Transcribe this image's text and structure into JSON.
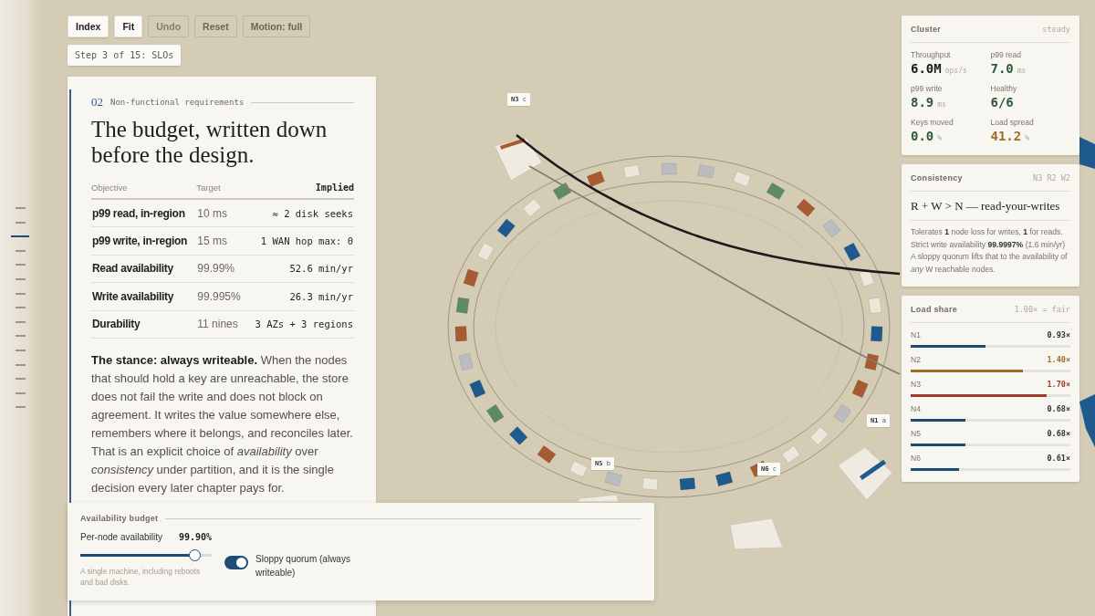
{
  "steps": [
    {
      "selected": false
    },
    {
      "selected": false
    },
    {
      "selected": true
    },
    {
      "selected": false
    },
    {
      "selected": false
    },
    {
      "selected": false
    },
    {
      "selected": false
    },
    {
      "selected": false
    },
    {
      "selected": false
    },
    {
      "selected": false
    },
    {
      "selected": false
    },
    {
      "selected": false
    },
    {
      "selected": false
    },
    {
      "selected": false
    },
    {
      "selected": false
    }
  ],
  "toolbar": [
    {
      "label": "Index",
      "kind": "filled",
      "disabled": false
    },
    {
      "label": "Fit",
      "kind": "filled",
      "disabled": false
    },
    {
      "label": "Undo",
      "kind": "outlined",
      "disabled": true
    },
    {
      "label": "Reset",
      "kind": "outlined",
      "disabled": false
    },
    {
      "label": "Motion: full",
      "kind": "outlined",
      "disabled": false
    }
  ],
  "step_label": "Step 3 of 15: SLOs",
  "chapter": {
    "number": "02",
    "label": "Non-functional requirements",
    "title": "The budget, written down before the design.",
    "table": {
      "columns": [
        "Objective",
        "Target",
        "Implied"
      ],
      "rows": [
        {
          "objective": "p99 read, in-region",
          "target": "10 ms",
          "implied": "≈ 2 disk seeks"
        },
        {
          "objective": "p99 write, in-region",
          "target": "15 ms",
          "implied": "1 WAN hop max: 0"
        },
        {
          "objective": "Read availability",
          "target": "99.99%",
          "implied": "52.6 min/yr"
        },
        {
          "objective": "Write availability",
          "target": "99.995%",
          "implied": "26.3 min/yr"
        },
        {
          "objective": "Durability",
          "target": "11 nines",
          "implied": "3 AZs + 3 regions"
        }
      ]
    },
    "body": "**The stance: always writeable.** When the nodes that should hold a key are unreachable, the store does not fail the write and does not block on agreement. It writes the value somewhere else, remembers where it belongs, and reconciles later. That is an explicit choice of *availability* over *consistency* under partition, and it is the single decision every later chapter pays for."
  },
  "budget": {
    "title": "Availability budget",
    "slider": {
      "label": "Per-node availability",
      "reading": "99.90%",
      "level": 0.87,
      "hint": "A single machine, including reboots and bad disks."
    },
    "toggle": {
      "label": "Sloppy quorum (always writeable)",
      "on": true
    }
  },
  "node_labels": [
    {
      "node": "N3",
      "replica": "c"
    },
    {
      "node": "N5",
      "replica": "b"
    },
    {
      "node": "N6",
      "replica": "c"
    },
    {
      "node": "N1",
      "replica": "a"
    }
  ],
  "cluster": {
    "title": "Cluster",
    "status": "steady",
    "metrics": [
      {
        "label": "Throughput",
        "value": "6.0M",
        "unit": "ops/s",
        "color": "#1c1c1c"
      },
      {
        "label": "p99 read",
        "value": "7.0",
        "unit": "ms",
        "color": "#2f5a3c"
      },
      {
        "label": "p99 write",
        "value": "8.9",
        "unit": "ms",
        "color": "#2f5a3c"
      },
      {
        "label": "Healthy",
        "value": "6/6",
        "color": "#2f5a3c"
      },
      {
        "label": "Keys moved",
        "value": "0.0",
        "unit": "%",
        "color": "#2f5a3c"
      },
      {
        "label": "Load spread",
        "value": "41.2",
        "unit": "%",
        "color": "#9a6f22"
      }
    ]
  },
  "consistency": {
    "title": "Consistency",
    "params": "N3 R2 W2",
    "formula": "R + W > N — read-your-writes",
    "lines": [
      "Tolerates **1** node loss for writes, **1** for reads.",
      "Strict write availability **99.9997%** (1.6 min/yr)",
      "A sloppy quorum lifts that to the availability of *any* W reachable nodes."
    ]
  },
  "load_share": {
    "title": "Load share",
    "note": "1.00× = fair",
    "nodes": [
      {
        "name": "N1",
        "value": "0.93×",
        "level": 0.47,
        "color": "#1f4b78"
      },
      {
        "name": "N2",
        "value": "1.40×",
        "level": 0.7,
        "color": "#9a6f22"
      },
      {
        "name": "N3",
        "value": "1.70×",
        "level": 0.85,
        "color": "#a13b29"
      },
      {
        "name": "N4",
        "value": "0.68×",
        "level": 0.34,
        "color": "#1f4b78"
      },
      {
        "name": "N5",
        "value": "0.68×",
        "level": 0.34,
        "color": "#1f4b78"
      },
      {
        "name": "N6",
        "value": "0.61×",
        "level": 0.3,
        "color": "#1f4b78"
      }
    ]
  }
}
